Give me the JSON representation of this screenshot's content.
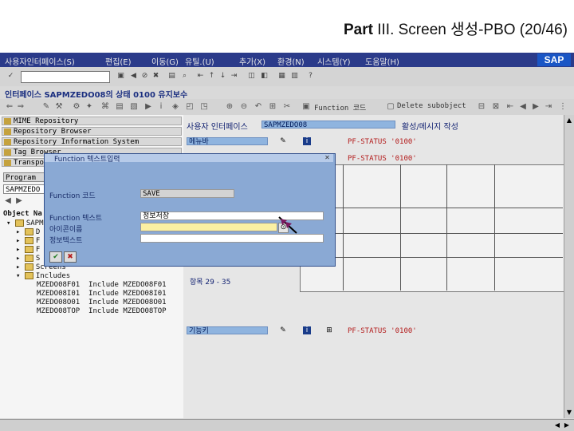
{
  "slide": {
    "title_part": "Part",
    "title_rest": "III. Screen 생성-PBO (20/46)"
  },
  "menubar": {
    "items": [
      "사용자인터페이스(S)",
      "편집(E)",
      "이동(G)",
      "유틸.(U)",
      "추가(X)",
      "환경(N)",
      "시스템(Y)",
      "도움말(H)"
    ]
  },
  "window_title": "인터페이스 SAPMZEDO08의 상태 0100 유지보수",
  "app_toolbar": {
    "function_code_btn": "Function 코드",
    "delete_subobject_btn": "Delete subobject"
  },
  "left_panel": {
    "repo_items": [
      "MIME Repository",
      "Repository Browser",
      "Repository Information System",
      "Tag Browser",
      "Transport Organizer"
    ],
    "program_label": "Program",
    "program_value": "SAPMZEDO",
    "object_header": "Object Na",
    "tree": [
      {
        "text": "SAPM",
        "indent": 0
      },
      {
        "text": "D",
        "indent": 1
      },
      {
        "text": "F",
        "indent": 1
      },
      {
        "text": "F",
        "indent": 1
      },
      {
        "text": "S",
        "indent": 1
      },
      {
        "text": "Screens",
        "indent": 1
      },
      {
        "text": "Includes",
        "indent": 1
      }
    ],
    "includes": [
      {
        "name": "MZEDO08F01",
        "type": "Include",
        "file": "MZEDO08F01"
      },
      {
        "name": "MZEDO08I01",
        "type": "Include",
        "file": "MZEDO08I01"
      },
      {
        "name": "MZEDO08O01",
        "type": "Include",
        "file": "MZEDO08O01"
      },
      {
        "name": "MZEDO08TOP",
        "type": "Include",
        "file": "MZEDO08TOP"
      }
    ]
  },
  "right_panel": {
    "interface_label": "사용자 인터페이스",
    "interface_value": "SAPMZEDO08",
    "active_label": "활성/메시지 작성",
    "menu_label": "메뉴바",
    "pf_status_1": "PF-STATUS '0100'",
    "pf_status_2": "PF-STATUS '0100'",
    "pf_status_3": "PF-STATUS '0100'",
    "items_label": "항목 29 - 35",
    "function_key_label": "기능키"
  },
  "dialog": {
    "title": "Function 텍스트입력",
    "func_code_label": "Function 코드",
    "func_code_value": "SAVE",
    "func_text_label": "Function 텍스트",
    "func_text_value": "정보저장",
    "icon_name_label": "아이콘이름",
    "icon_name_value": "",
    "info_text_label": "정보텍스트",
    "info_text_value": ""
  },
  "colors": {
    "menubar_bg": "#2b3b8a",
    "dialog_bg": "#8aa9d4",
    "status_red": "#b31b1b",
    "blue_field": "#8fb4df"
  }
}
